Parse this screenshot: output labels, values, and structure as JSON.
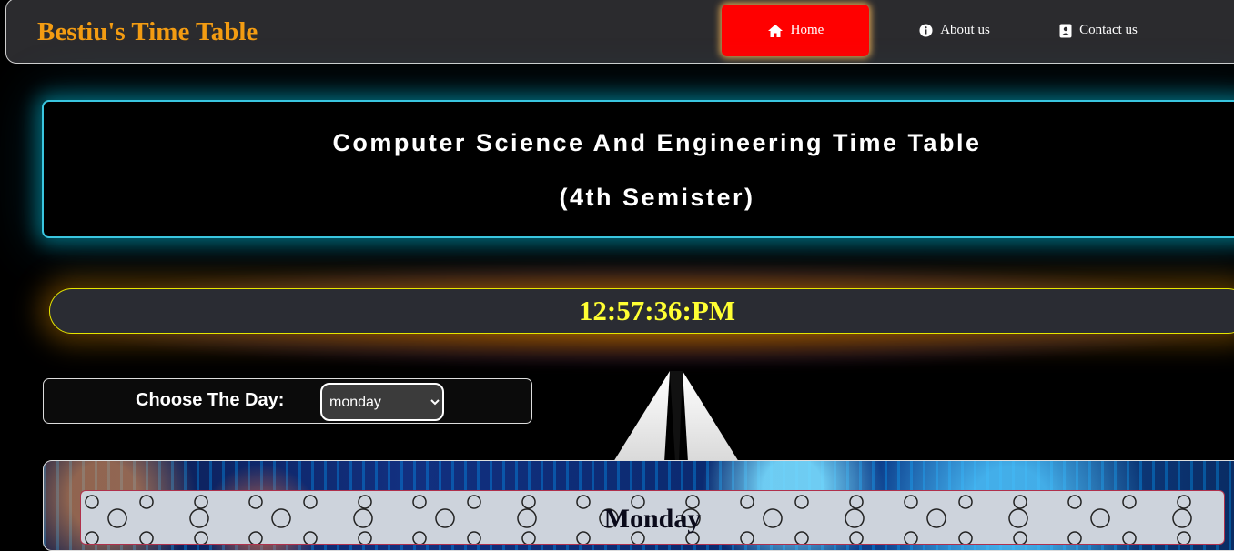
{
  "brand": "Bestiu's Time Table",
  "nav": {
    "home": "Home",
    "about": "About us",
    "contact": "Contact us"
  },
  "title": {
    "line1": "Computer Science And Engineering Time Table",
    "line2": "(4th Semister)"
  },
  "clock": "12:57:36:PM",
  "day_chooser": {
    "label": "Choose The Day:",
    "selected": "monday"
  },
  "timetable": {
    "day_heading": "Monday"
  },
  "colors": {
    "brand": "#f39c12",
    "home_active": "#ff0000",
    "clock_text": "#ffff33",
    "title_glow": "#3ac6e0"
  }
}
